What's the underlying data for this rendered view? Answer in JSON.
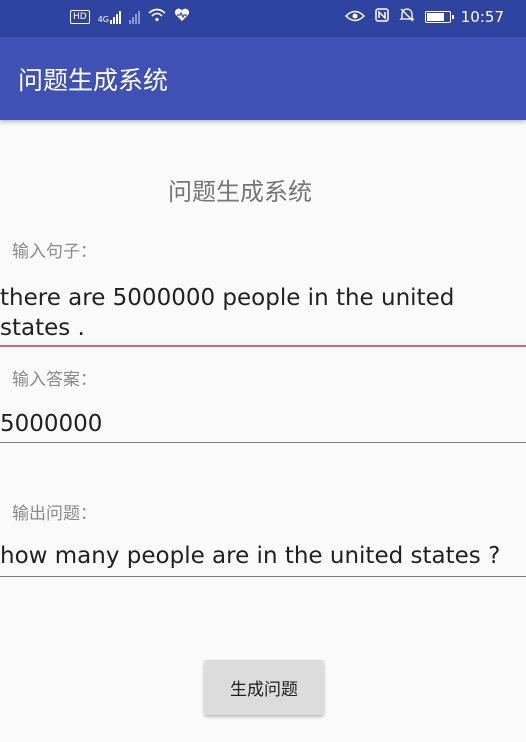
{
  "status_bar": {
    "left_icons": [
      "hd-icon",
      "signal-4g-icon",
      "signal-icon",
      "wifi-icon",
      "health-icon"
    ],
    "right_icons": [
      "eye-icon",
      "nfc-icon",
      "mute-icon",
      "battery-icon"
    ],
    "time": "10:57",
    "hd_badge": "HD",
    "network": "4G"
  },
  "app_bar": {
    "title": "问题生成系统"
  },
  "main": {
    "heading": "问题生成系统",
    "sentence_label": "输入句子：",
    "sentence_value": "there are 5000000 people in the united states .",
    "answer_label": "输入答案：",
    "answer_value": "5000000",
    "output_label": "输出问题：",
    "output_value": "how many people are in the united states ?",
    "generate_button": "生成问题"
  },
  "colors": {
    "status_bar": "#2f44a0",
    "app_bar": "#3f51b5",
    "focused_underline": "#d96088",
    "background": "#fafafa"
  }
}
